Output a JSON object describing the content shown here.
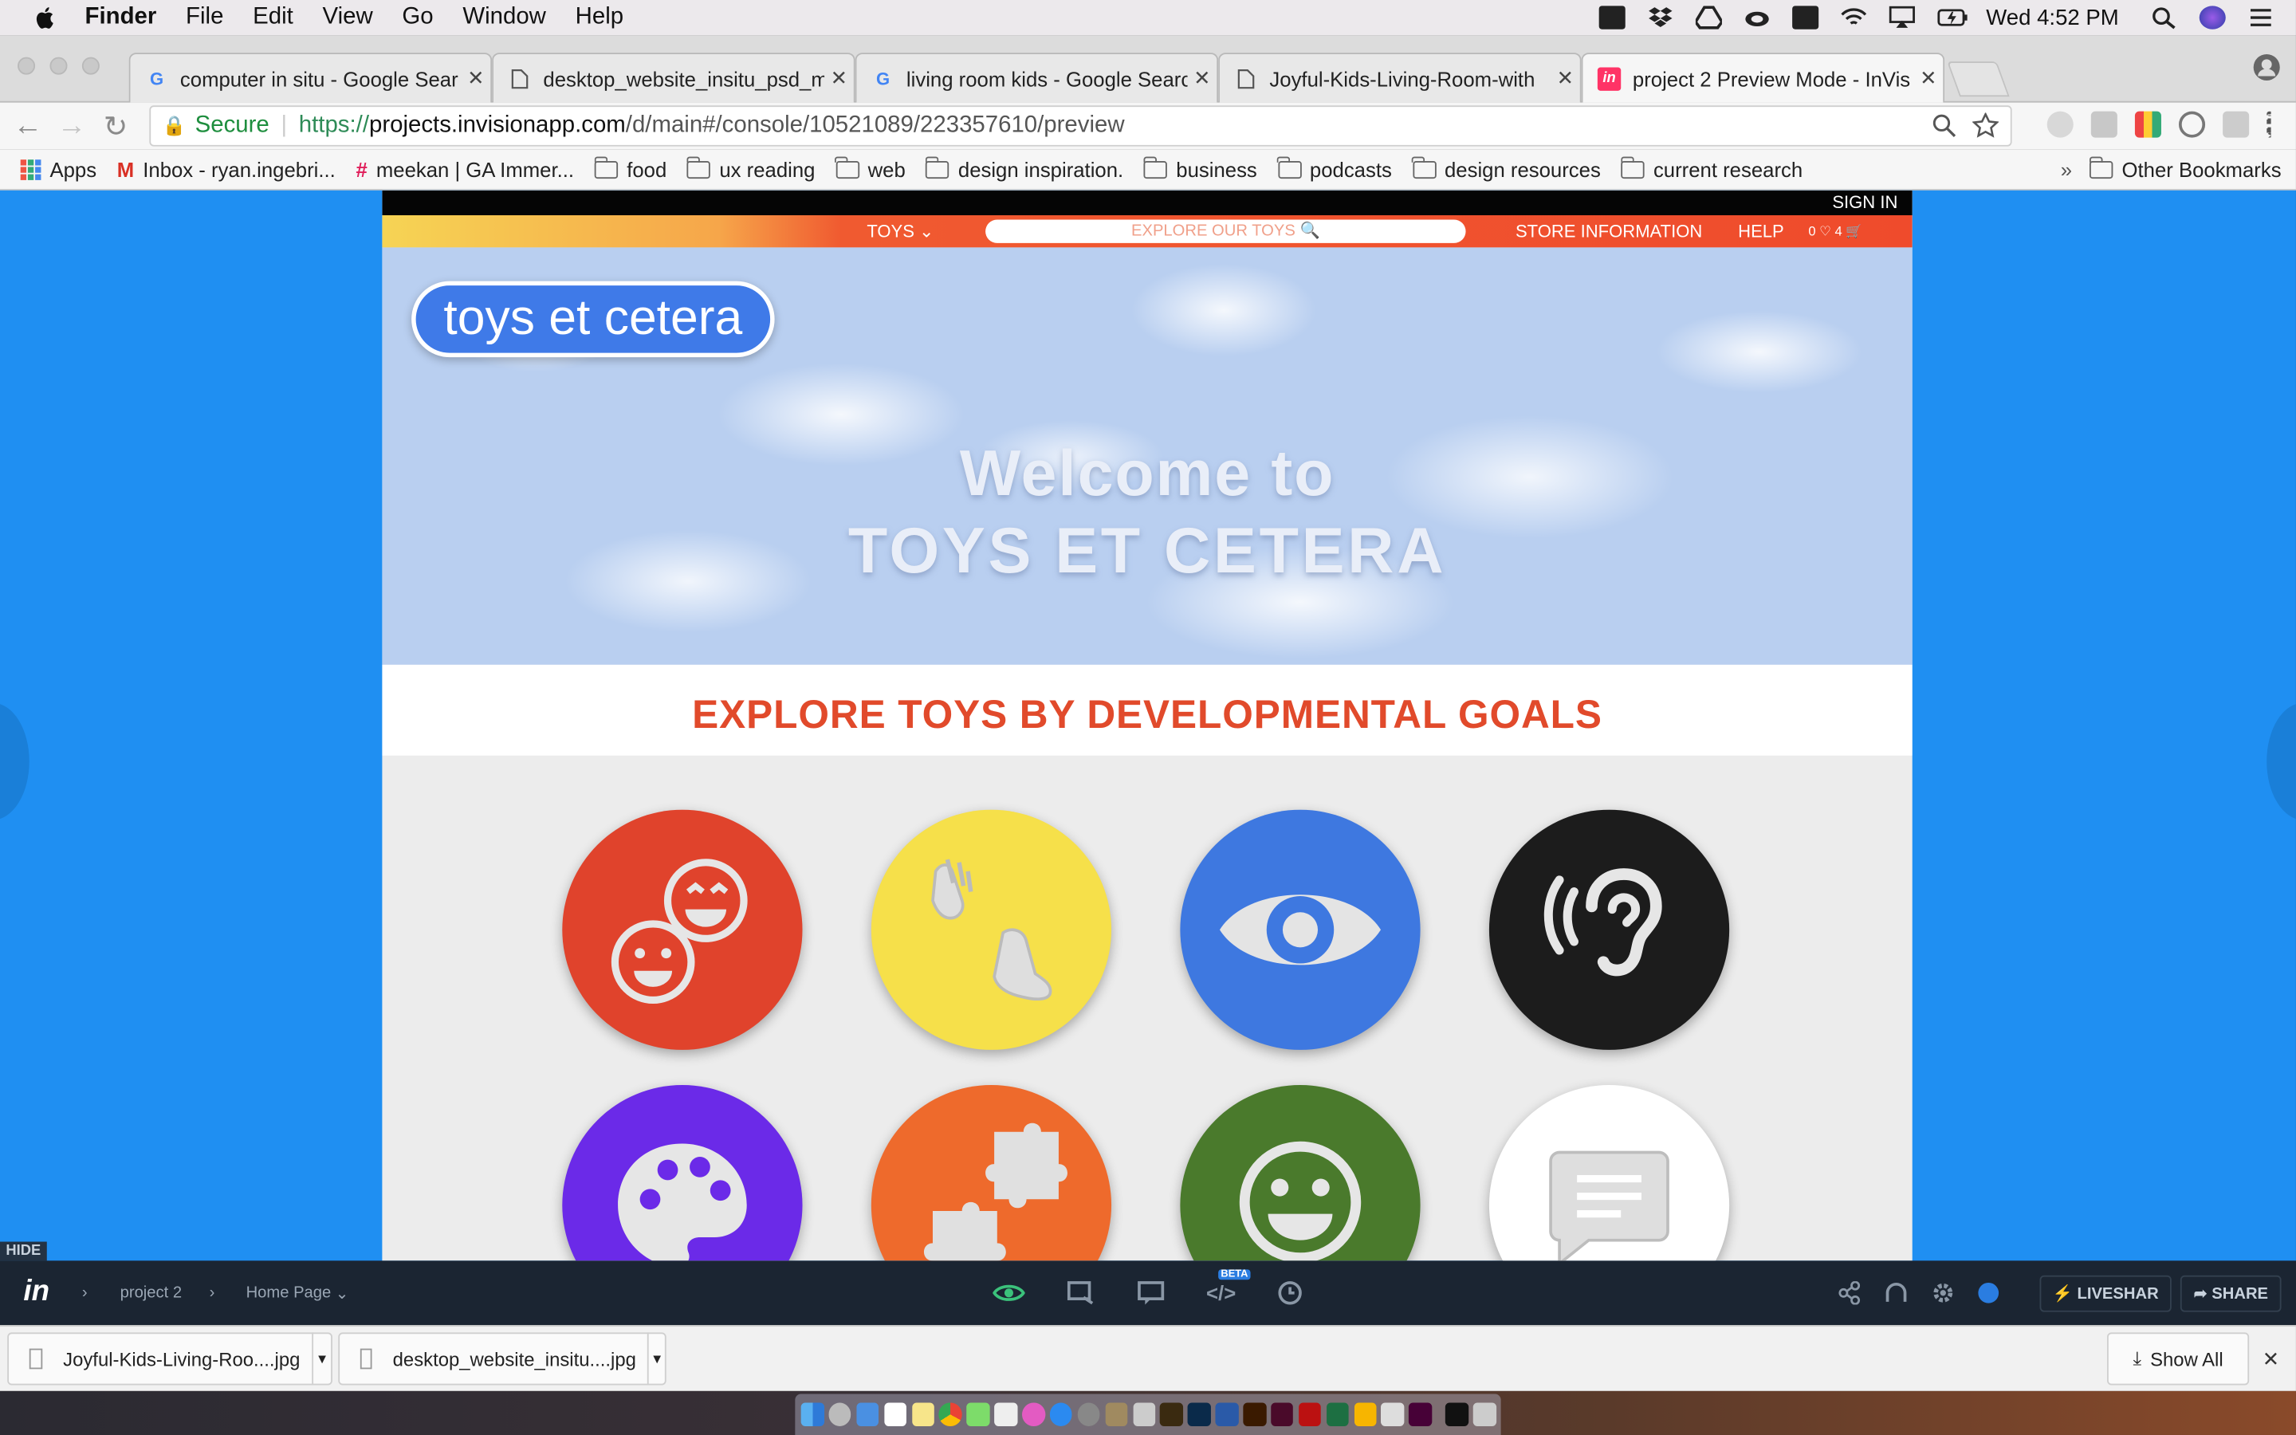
{
  "menubar": {
    "app": "Finder",
    "items": [
      "File",
      "Edit",
      "View",
      "Go",
      "Window",
      "Help"
    ],
    "clock": "Wed 4:52 PM"
  },
  "tabs": [
    {
      "title": "computer in situ - Google Sear",
      "favicon": "google-icon"
    },
    {
      "title": "desktop_website_insitu_psd_m",
      "favicon": "document-icon"
    },
    {
      "title": "living room kids - Google Searc",
      "favicon": "google-icon"
    },
    {
      "title": "Joyful-Kids-Living-Room-with",
      "favicon": "document-icon"
    },
    {
      "title": "project 2 Preview Mode - InVis",
      "favicon": "invision-icon"
    }
  ],
  "address": {
    "secure_label": "Secure",
    "scheme": "https://",
    "host": "projects.invisionapp.com",
    "path": "/d/main#/console/10521089/223357610/preview"
  },
  "bookmarks": {
    "items": [
      "Apps",
      "Inbox - ryan.ingebri...",
      "meekan | GA Immer...",
      "food",
      "ux reading",
      "web",
      "design inspiration.",
      "business",
      "podcasts",
      "design resources",
      "current research"
    ],
    "overflow": "»",
    "other": "Other Bookmarks"
  },
  "site": {
    "sign_in": "SIGN IN",
    "nav_toys": "TOYS ⌄",
    "search_placeholder": "EXPLORE OUR TOYS  🔍",
    "store_info": "STORE INFORMATION",
    "help": "HELP",
    "cart_counts": "0  ♡ 4  🛒",
    "logo": "toys et cetera",
    "welcome_line1": "Welcome to",
    "welcome_line2": "TOYS ET CETERA",
    "explore_title": "EXPLORE TOYS BY DEVELOPMENTAL GOALS",
    "goals": [
      {
        "icon": "smiley-faces-icon",
        "color": "#e0432c"
      },
      {
        "icon": "hand-foot-icon",
        "color": "#f6e04a"
      },
      {
        "icon": "eye-icon",
        "color": "#3e78e0"
      },
      {
        "icon": "ear-icon",
        "color": "#1c1c1c"
      },
      {
        "icon": "palette-icon",
        "color": "#6b2ae8"
      },
      {
        "icon": "puzzle-icon",
        "color": "#ee6a2c"
      },
      {
        "icon": "smiley-icon",
        "color": "#4a7a2c"
      },
      {
        "icon": "speech-bubble-icon",
        "color": "#ffffff"
      }
    ]
  },
  "invision": {
    "hide_label": "HIDE",
    "project": "project 2",
    "screen": "Home Page",
    "beta": "BETA",
    "liveshare": "LIVESHAR",
    "share": "SHARE"
  },
  "downloads": {
    "items": [
      "Joyful-Kids-Living-Roo....jpg",
      "desktop_website_insitu....jpg"
    ],
    "show_all": "Show All"
  }
}
